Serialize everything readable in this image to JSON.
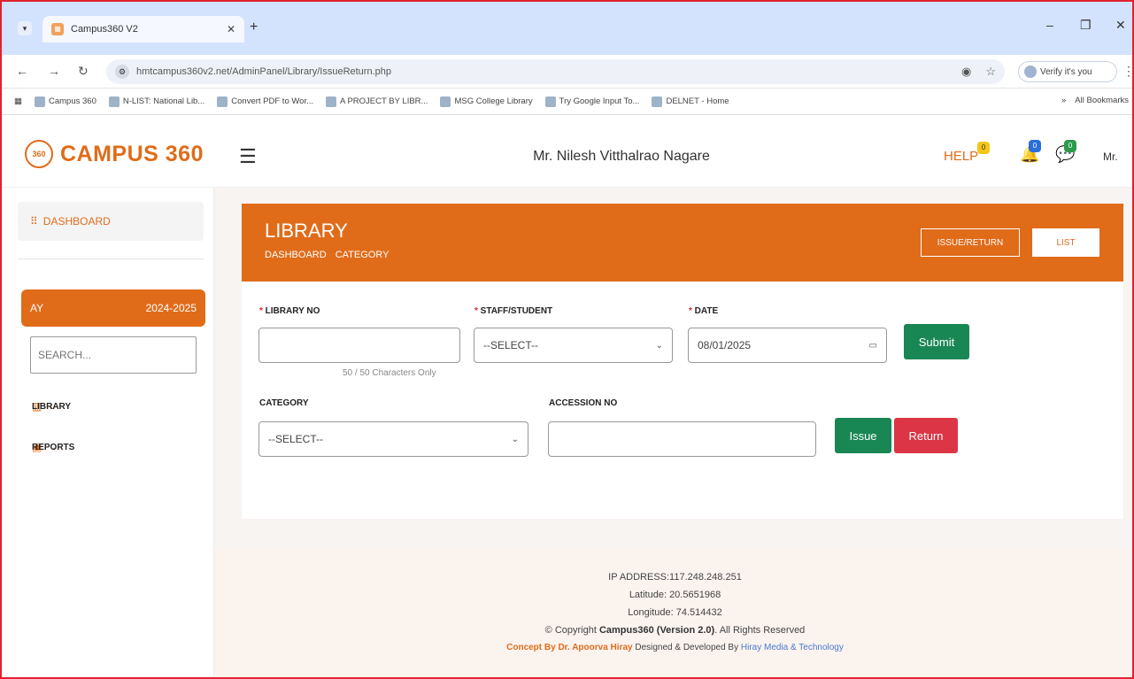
{
  "browser": {
    "tab_title": "Campus360 V2",
    "url": "hmtcampus360v2.net/AdminPanel/Library/IssueReturn.php",
    "verify_label": "Verify it's you",
    "bookmarks": [
      "Campus 360",
      "N-LIST: National Lib...",
      "Convert PDF to Wor...",
      "A PROJECT BY LIBR...",
      "MSG College Library",
      "Try Google Input To...",
      "DELNET - Home"
    ],
    "all_bookmarks": "All Bookmarks"
  },
  "header": {
    "brand": "CAMPUS 360",
    "logo_text": "360",
    "user_name": "Mr. Nilesh Vitthalrao Nagare",
    "help": "HELP",
    "help_badge": "0",
    "bell_badge": "0",
    "chat_badge": "0",
    "user_short": "Mr."
  },
  "sidebar": {
    "dashboard": "DASHBOARD",
    "ay_label": "AY",
    "ay_value": "2024-2025",
    "search_placeholder": "SEARCH...",
    "library": "LIBRARY",
    "reports": "REPORTS"
  },
  "panel": {
    "title": "LIBRARY",
    "crumb_dashboard": "DASHBOARD",
    "crumb_category": "CATEGORY",
    "issue_return_btn": "ISSUE/RETURN",
    "list_btn": "LIST"
  },
  "form": {
    "library_no_label": "LIBRARY NO",
    "library_no_value": "",
    "library_no_hint": "50 / 50 Characters Only",
    "staff_student_label": "STAFF/STUDENT",
    "staff_student_value": "--SELECT--",
    "date_label": "DATE",
    "date_value": "08/01/2025",
    "submit": "Submit",
    "category_label": "CATEGORY",
    "category_value": "--SELECT--",
    "accession_label": "ACCESSION NO",
    "accession_value": "",
    "issue": "Issue",
    "return": "Return"
  },
  "footer": {
    "ip": "IP ADDRESS:117.248.248.251",
    "latitude": "Latitude: 20.5651968",
    "longitude": "Longitude: 74.514432",
    "copyright_pre": "© Copyright ",
    "copyright_brand": "Campus360 (Version 2.0)",
    "copyright_post": ". All Rights Reserved",
    "concept": "Concept By Dr. Apoorva Hiray",
    "designed": " Designed & Developed By ",
    "company": "Hiray Media & Technology"
  }
}
